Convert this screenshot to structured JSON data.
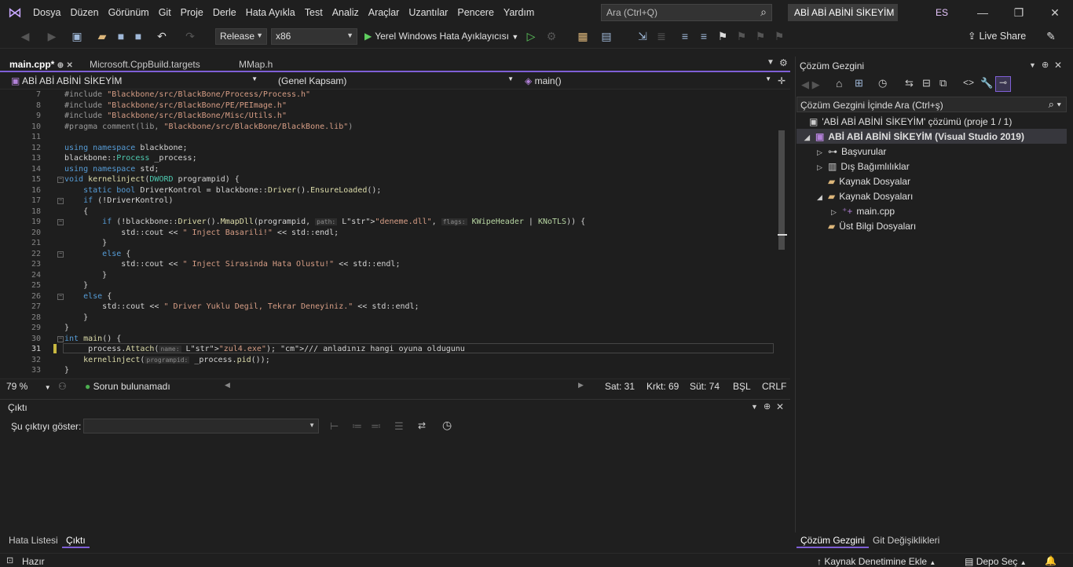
{
  "menu": [
    "Dosya",
    "Düzen",
    "Görünüm",
    "Git",
    "Proje",
    "Derle",
    "Hata Ayıkla",
    "Test",
    "Analiz",
    "Araçlar",
    "Uzantılar",
    "Pencere",
    "Yardım"
  ],
  "search": {
    "placeholder": "Ara (Ctrl+Q)"
  },
  "solution_name": "ABİ ABİ ABİNİ SİKEYİM",
  "user_initials": "ES",
  "toolbar": {
    "config": "Release",
    "platform": "x86",
    "debug_label": "Yerel Windows Hata Ayıklayıcısı",
    "live_share": "Live Share"
  },
  "tabs": [
    {
      "label": "main.cpp*",
      "active": true
    },
    {
      "label": "Microsoft.CppBuild.targets"
    },
    {
      "label": "MMap.h"
    }
  ],
  "navbar": {
    "project": "ABİ ABİ ABİNİ SİKEYİM",
    "scope": "(Genel Kapsam)",
    "member": "main()"
  },
  "editor": {
    "current_line": 31,
    "lines": [
      {
        "n": 7,
        "t": "#include \"Blackbone/src/BlackBone/Process/Process.h\""
      },
      {
        "n": 8,
        "t": "#include \"Blackbone/src/BlackBone/PE/PEImage.h\""
      },
      {
        "n": 9,
        "t": "#include \"Blackbone/src/BlackBone/Misc/Utils.h\""
      },
      {
        "n": 10,
        "t": "#pragma comment(lib, \"Blackbone/src/BlackBone/BlackBone.lib\")"
      },
      {
        "n": 11,
        "t": ""
      },
      {
        "n": 12,
        "t": "using namespace blackbone;"
      },
      {
        "n": 13,
        "t": "blackbone::Process _process;"
      },
      {
        "n": 14,
        "t": "using namespace std;"
      },
      {
        "n": 15,
        "t": "void kernelinject(DWORD programpid) {"
      },
      {
        "n": 16,
        "t": "    static bool DriverKontrol = blackbone::Driver().EnsureLoaded();"
      },
      {
        "n": 17,
        "t": "    if (!DriverKontrol)"
      },
      {
        "n": 18,
        "t": "    {"
      },
      {
        "n": 19,
        "t": "        if (!blackbone::Driver().MmapDll(programpid, path: L\"deneme.dll\", flags: KWipeHeader | KNoTLS)) {"
      },
      {
        "n": 20,
        "t": "            std::cout << \" Inject Basarili!\" << std::endl;"
      },
      {
        "n": 21,
        "t": "        }"
      },
      {
        "n": 22,
        "t": "        else {"
      },
      {
        "n": 23,
        "t": "            std::cout << \" Inject Sirasinda Hata Olustu!\" << std::endl;"
      },
      {
        "n": 24,
        "t": "        }"
      },
      {
        "n": 25,
        "t": "    }"
      },
      {
        "n": 26,
        "t": "    else {"
      },
      {
        "n": 27,
        "t": "        std::cout << \" Driver Yuklu Degil, Tekrar Deneyiniz.\" << std::endl;"
      },
      {
        "n": 28,
        "t": "    }"
      },
      {
        "n": 29,
        "t": "}"
      },
      {
        "n": 30,
        "t": "int main() {"
      },
      {
        "n": 31,
        "t": "    _process.Attach(name: L\"zul4.exe\"); /// anladınız hangi oyuna oldugunu"
      },
      {
        "n": 32,
        "t": "    kernelinject(programpid: _process.pid());"
      },
      {
        "n": 33,
        "t": "}"
      }
    ]
  },
  "status_line": {
    "zoom": "79 %",
    "issues": "Sorun bulunamadı",
    "line": "Sat: 31",
    "char": "Krkt: 69",
    "col": "Süt: 74",
    "tab": "BŞL",
    "eol": "CRLF"
  },
  "output": {
    "title": "Çıktı",
    "show_label": "Şu çıktıyı göster:"
  },
  "bottom_tabs": [
    "Hata Listesi",
    "Çıktı"
  ],
  "statusbar": {
    "ready": "Hazır",
    "add_source": "Kaynak Denetimine Ekle",
    "repo": "Depo Seç"
  },
  "solution_explorer": {
    "title": "Çözüm Gezgini",
    "search": "Çözüm Gezgini İçinde Ara (Ctrl+ş)",
    "solution": "'ABİ ABİ ABİNİ SİKEYİM' çözümü (proje 1 / 1)",
    "project": "ABİ ABİ ABİNİ SİKEYİM (Visual Studio 2019)",
    "items": [
      "Başvurular",
      "Dış Bağımlılıklar",
      "Kaynak Dosyalar",
      "Kaynak Dosyaları",
      "main.cpp",
      "Üst Bilgi Dosyaları"
    ],
    "tabs": [
      "Çözüm Gezgini",
      "Git Değişiklikleri"
    ]
  },
  "colors": {
    "accent": "#7f5fd6",
    "keyword": "#569cd6",
    "string": "#d69d85",
    "comment": "#57a64a"
  }
}
